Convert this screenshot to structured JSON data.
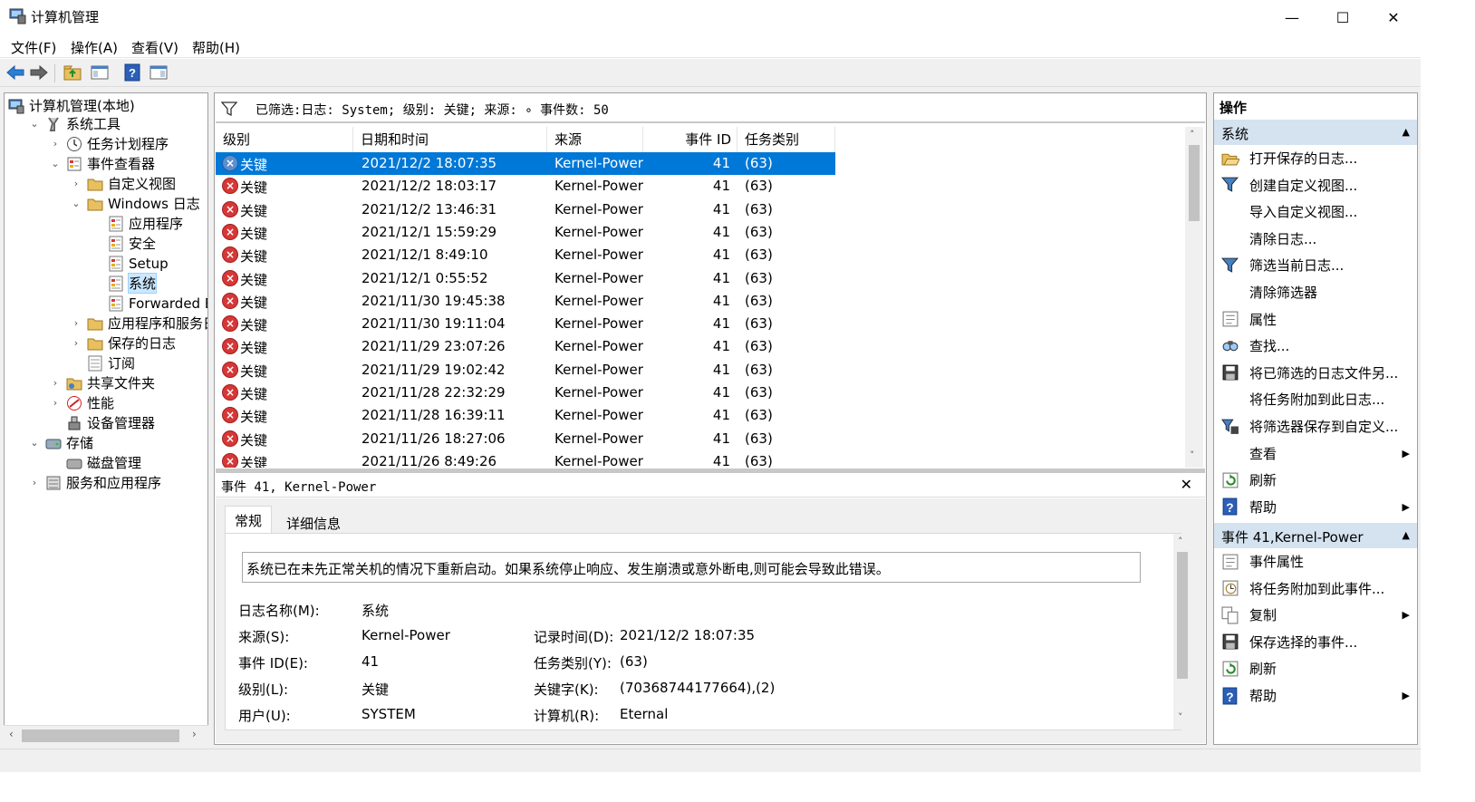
{
  "window": {
    "title": "计算机管理",
    "minimize": "—",
    "maximize": "☐",
    "close": "✕"
  },
  "menu": [
    "文件(F)",
    "操作(A)",
    "查看(V)",
    "帮助(H)"
  ],
  "tree": [
    {
      "label": "计算机管理(本地)",
      "icon": "computer-icon"
    },
    {
      "label": "系统工具",
      "icon": "tools-icon"
    },
    {
      "label": "任务计划程序",
      "icon": "clock-icon"
    },
    {
      "label": "事件查看器",
      "icon": "event-viewer-icon"
    },
    {
      "label": "自定义视图",
      "icon": "folder-icon"
    },
    {
      "label": "Windows 日志",
      "icon": "folder-icon"
    },
    {
      "label": "应用程序",
      "icon": "log-icon"
    },
    {
      "label": "安全",
      "icon": "log-icon"
    },
    {
      "label": "Setup",
      "icon": "log-icon"
    },
    {
      "label": "系统",
      "icon": "log-icon"
    },
    {
      "label": "Forwarded Even",
      "icon": "log-icon"
    },
    {
      "label": "应用程序和服务日志",
      "icon": "folder-icon"
    },
    {
      "label": "保存的日志",
      "icon": "folder-icon"
    },
    {
      "label": "订阅",
      "icon": "subscription-icon"
    },
    {
      "label": "共享文件夹",
      "icon": "shared-folder-icon"
    },
    {
      "label": "性能",
      "icon": "performance-icon"
    },
    {
      "label": "设备管理器",
      "icon": "device-icon"
    },
    {
      "label": "存储",
      "icon": "storage-icon"
    },
    {
      "label": "磁盘管理",
      "icon": "disk-icon"
    },
    {
      "label": "服务和应用程序",
      "icon": "services-icon"
    }
  ],
  "filter": {
    "text": "已筛选:日志: System; 级别: 关键; 来源: ∘ 事件数: 50"
  },
  "columns": {
    "level": "级别",
    "datetime": "日期和时间",
    "source": "来源",
    "event_id": "事件 ID",
    "task": "任务类别"
  },
  "rows": [
    {
      "level": "关键",
      "datetime": "2021/12/2 18:07:35",
      "source": "Kernel-Power",
      "id": "41",
      "task": "(63)"
    },
    {
      "level": "关键",
      "datetime": "2021/12/2 18:03:17",
      "source": "Kernel-Power",
      "id": "41",
      "task": "(63)"
    },
    {
      "level": "关键",
      "datetime": "2021/12/2 13:46:31",
      "source": "Kernel-Power",
      "id": "41",
      "task": "(63)"
    },
    {
      "level": "关键",
      "datetime": "2021/12/1 15:59:29",
      "source": "Kernel-Power",
      "id": "41",
      "task": "(63)"
    },
    {
      "level": "关键",
      "datetime": "2021/12/1 8:49:10",
      "source": "Kernel-Power",
      "id": "41",
      "task": "(63)"
    },
    {
      "level": "关键",
      "datetime": "2021/12/1 0:55:52",
      "source": "Kernel-Power",
      "id": "41",
      "task": "(63)"
    },
    {
      "level": "关键",
      "datetime": "2021/11/30 19:45:38",
      "source": "Kernel-Power",
      "id": "41",
      "task": "(63)"
    },
    {
      "level": "关键",
      "datetime": "2021/11/30 19:11:04",
      "source": "Kernel-Power",
      "id": "41",
      "task": "(63)"
    },
    {
      "level": "关键",
      "datetime": "2021/11/29 23:07:26",
      "source": "Kernel-Power",
      "id": "41",
      "task": "(63)"
    },
    {
      "level": "关键",
      "datetime": "2021/11/29 19:02:42",
      "source": "Kernel-Power",
      "id": "41",
      "task": "(63)"
    },
    {
      "level": "关键",
      "datetime": "2021/11/28 22:32:29",
      "source": "Kernel-Power",
      "id": "41",
      "task": "(63)"
    },
    {
      "level": "关键",
      "datetime": "2021/11/28 16:39:11",
      "source": "Kernel-Power",
      "id": "41",
      "task": "(63)"
    },
    {
      "level": "关键",
      "datetime": "2021/11/26 18:27:06",
      "source": "Kernel-Power",
      "id": "41",
      "task": "(63)"
    },
    {
      "level": "关键",
      "datetime": "2021/11/26 8:49:26",
      "source": "Kernel-Power",
      "id": "41",
      "task": "(63)"
    }
  ],
  "detail": {
    "header": "事件 41, Kernel-Power",
    "tab_general": "常规",
    "tab_details": "详细信息",
    "description": "系统已在未先正常关机的情况下重新启动。如果系统停止响应、发生崩溃或意外断电,则可能会导致此错误。",
    "log_name_label": "日志名称(M):",
    "log_name": "系统",
    "source_label": "来源(S):",
    "source": "Kernel-Power",
    "logged_label": "记录时间(D):",
    "logged": "2021/12/2 18:07:35",
    "event_id_label": "事件 ID(E):",
    "event_id": "41",
    "task_label": "任务类别(Y):",
    "task": "(63)",
    "level_label": "级别(L):",
    "level": "关键",
    "keywords_label": "关键字(K):",
    "keywords": "(70368744177664),(2)",
    "user_label": "用户(U):",
    "user": "SYSTEM",
    "computer_label": "计算机(R):",
    "computer": "Eternal"
  },
  "actions": {
    "title": "操作",
    "section1": "系统",
    "items1": [
      {
        "label": "打开保存的日志...",
        "icon": "open-folder-icon"
      },
      {
        "label": "创建自定义视图...",
        "icon": "filter-icon"
      },
      {
        "label": "导入自定义视图...",
        "icon": ""
      },
      {
        "label": "清除日志...",
        "icon": ""
      },
      {
        "label": "筛选当前日志...",
        "icon": "filter-icon"
      },
      {
        "label": "清除筛选器",
        "icon": ""
      },
      {
        "label": "属性",
        "icon": "properties-icon"
      },
      {
        "label": "查找...",
        "icon": "find-icon"
      },
      {
        "label": "将已筛选的日志文件另...",
        "icon": "save-icon"
      },
      {
        "label": "将任务附加到此日志...",
        "icon": ""
      },
      {
        "label": "将筛选器保存到自定义...",
        "icon": "save-filter-icon"
      },
      {
        "label": "查看",
        "icon": ""
      },
      {
        "label": "刷新",
        "icon": "refresh-icon"
      },
      {
        "label": "帮助",
        "icon": "help-icon"
      }
    ],
    "section2": "事件 41,Kernel-Power",
    "items2": [
      {
        "label": "事件属性",
        "icon": "properties-icon"
      },
      {
        "label": "将任务附加到此事件...",
        "icon": "task-icon"
      },
      {
        "label": "复制",
        "icon": "copy-icon"
      },
      {
        "label": "保存选择的事件...",
        "icon": "save-icon"
      },
      {
        "label": "刷新",
        "icon": "refresh-icon"
      },
      {
        "label": "帮助",
        "icon": "help-icon"
      }
    ]
  },
  "colors": {
    "selection": "#0078d7",
    "action_header": "#d5e3f0",
    "error": "#d63737"
  }
}
